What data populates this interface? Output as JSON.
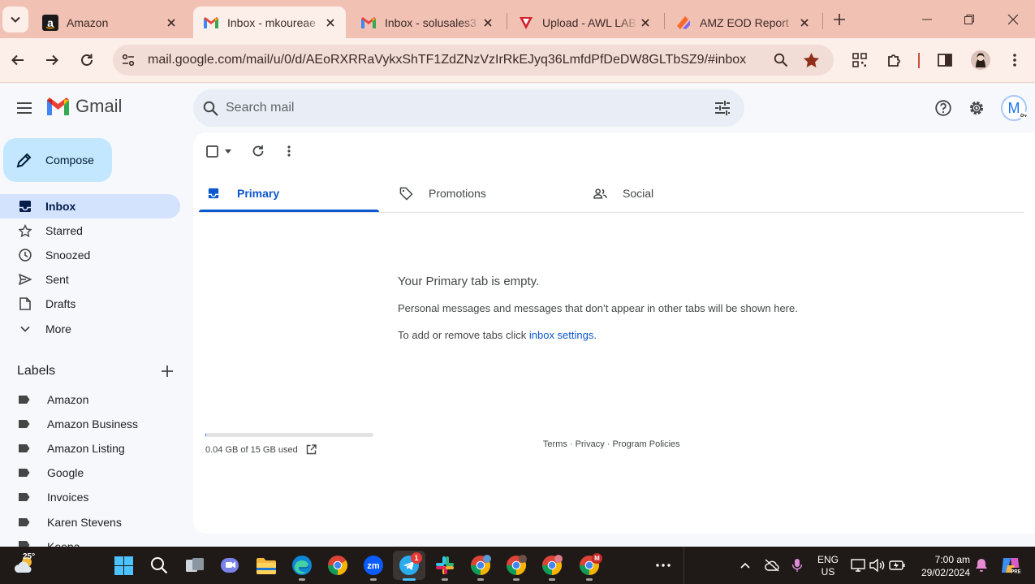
{
  "browser": {
    "tabs": [
      {
        "title": "Amazon",
        "favicon": "amazon-icon",
        "active": false
      },
      {
        "title": "Inbox - mkoureae",
        "favicon": "gmail-icon",
        "active": true
      },
      {
        "title": "Inbox - solusales3",
        "favicon": "gmail-icon",
        "active": false
      },
      {
        "title": "Upload - AWL LAB",
        "favicon": "awl-icon",
        "active": false
      },
      {
        "title": "AMZ EOD Report",
        "favicon": "clickup-icon",
        "active": false
      }
    ],
    "url": "mail.google.com/mail/u/0/d/AEoRXRRaVykxShTF1ZdZNzVzIrRkEJyq36LmfdPfDeDW8GLTbSZ9/#inbox"
  },
  "gmail": {
    "logo_text": "Gmail",
    "search_placeholder": "Search mail",
    "avatar_letter": "M",
    "compose_label": "Compose",
    "nav": [
      {
        "label": "Inbox",
        "icon": "inbox-icon",
        "selected": true
      },
      {
        "label": "Starred",
        "icon": "star-icon"
      },
      {
        "label": "Snoozed",
        "icon": "clock-icon"
      },
      {
        "label": "Sent",
        "icon": "send-icon"
      },
      {
        "label": "Drafts",
        "icon": "draft-icon"
      },
      {
        "label": "More",
        "icon": "chevron-down-icon"
      }
    ],
    "labels_heading": "Labels",
    "labels": [
      "Amazon",
      "Amazon Business",
      "Amazon Listing",
      "Google",
      "Invoices",
      "Karen Stevens",
      "Keepa"
    ],
    "category_tabs": [
      {
        "label": "Primary",
        "icon": "inbox-icon",
        "selected": true
      },
      {
        "label": "Promotions",
        "icon": "tag-icon"
      },
      {
        "label": "Social",
        "icon": "people-icon"
      }
    ],
    "empty": {
      "title": "Your Primary tab is empty.",
      "line1": "Personal messages and messages that don’t appear in other tabs will be shown here.",
      "line2_prefix": "To add or remove tabs click ",
      "line2_link": "inbox settings",
      "line2_suffix": "."
    },
    "storage": {
      "text": "0.04 GB of 15 GB used",
      "used_fraction": 0.003
    },
    "footer": {
      "terms": "Terms",
      "sep": " · ",
      "privacy": "Privacy",
      "policies": "Program Policies"
    }
  },
  "taskbar": {
    "weather": "25°",
    "telegram_badge": "1",
    "chrome_badge": "M",
    "lang": "ENG",
    "region": "US",
    "time": "7:00 am",
    "date": "29/02/2024"
  },
  "colors": {
    "tabbar": "#f1c1b4",
    "toolbar": "#fcefe9",
    "gmail_bg": "#f6f8fc",
    "selected_nav": "#d3e3fd",
    "compose": "#c2e7ff",
    "accent": "#0b57d0",
    "taskbar": "#1f1a17"
  }
}
